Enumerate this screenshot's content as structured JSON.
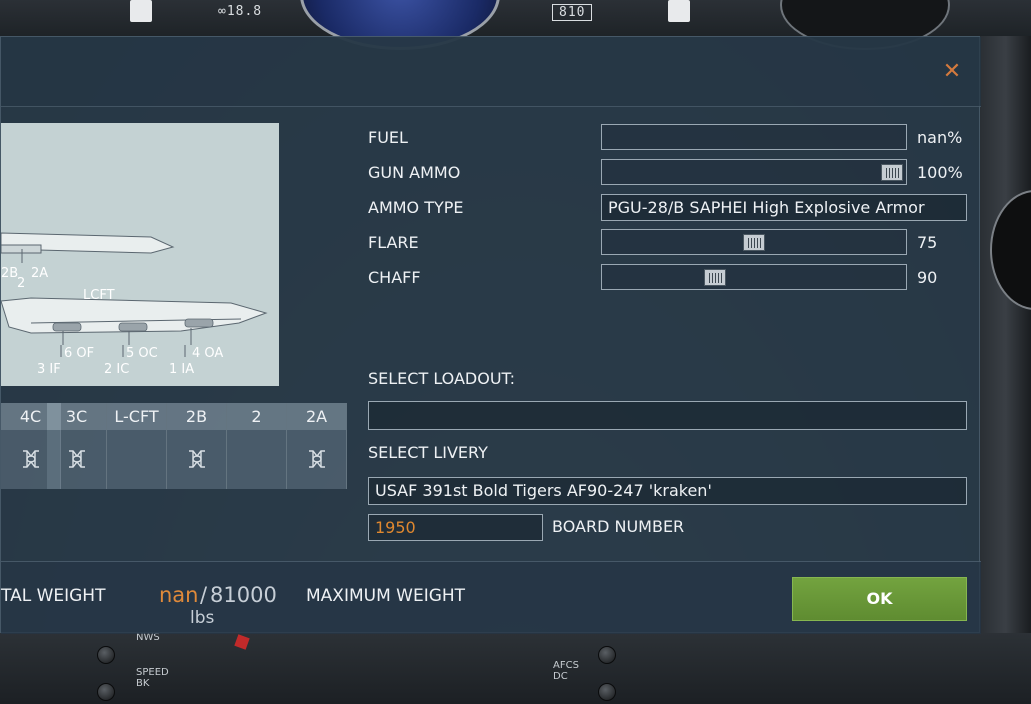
{
  "cockpit": {
    "top_readout_left": "∞18.8",
    "top_readout_right": "810",
    "bottom_labels": [
      "NWS",
      "SPEED BK",
      "AFCS DC"
    ]
  },
  "dialog": {
    "close_icon": "close-icon",
    "accent_color": "#e0882f",
    "diagram": {
      "labels": [
        "2B",
        "2",
        "2A",
        "LCFT",
        "6 OF",
        "5 OC",
        "4 OA",
        "3 IF",
        "2 IC",
        "1 IA"
      ]
    },
    "pylons": [
      {
        "label": "4C",
        "icon": "bomb-rack-icon",
        "loaded": true
      },
      {
        "label": "3C",
        "icon": "bomb-rack-icon",
        "loaded": true
      },
      {
        "label": "L-CFT",
        "icon": "",
        "loaded": false
      },
      {
        "label": "2B",
        "icon": "bomb-rack-icon",
        "loaded": true
      },
      {
        "label": "2",
        "icon": "",
        "loaded": false
      },
      {
        "label": "2A",
        "icon": "bomb-rack-icon",
        "loaded": true
      }
    ],
    "stores": {
      "fuel": {
        "label": "FUEL",
        "value": "nan%",
        "fraction": null
      },
      "gun_ammo": {
        "label": "GUN AMMO",
        "value": "100%",
        "fraction": 1.0
      },
      "ammo_type": {
        "label": "AMMO TYPE",
        "value": "PGU-28/B SAPHEI High Explosive Armor"
      },
      "flare": {
        "label": "FLARE",
        "value": "75",
        "fraction": 0.5
      },
      "chaff": {
        "label": "CHAFF",
        "value": "90",
        "fraction": 0.36
      }
    },
    "loadout": {
      "label": "SELECT LOADOUT:",
      "value": ""
    },
    "livery": {
      "label": "SELECT LIVERY",
      "value": "USAF 391st Bold Tigers AF90-247 'kraken'"
    },
    "board_number": {
      "label": "BOARD NUMBER",
      "value": "1950"
    },
    "footer": {
      "total_label": "TAL WEIGHT",
      "current_weight": "nan",
      "separator": "/",
      "max_weight": "81000",
      "unit": "lbs",
      "max_label": "MAXIMUM WEIGHT",
      "ok_label": "OK"
    }
  }
}
